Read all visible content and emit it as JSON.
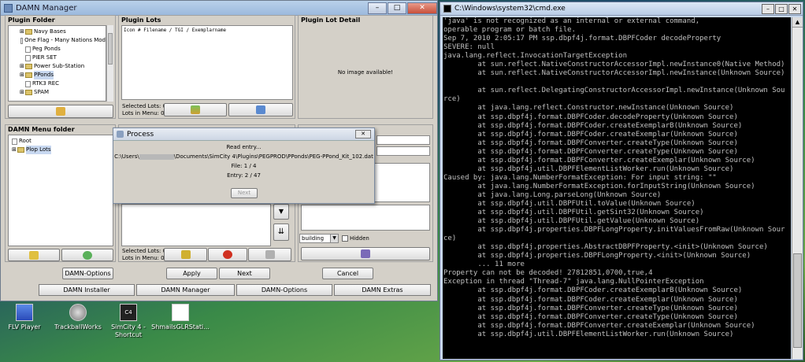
{
  "desktop": {
    "icons": [
      {
        "name": "flv-player-icon",
        "label": "FLV Player"
      },
      {
        "name": "trackball-works-icon",
        "label": "TrackballWorks"
      },
      {
        "name": "simcity4-shortcut-icon",
        "label": "SimCity 4 -",
        "label2": "Shortcut"
      },
      {
        "name": "shmails-icon",
        "label": "ShmailsGLRStati..."
      }
    ]
  },
  "damn": {
    "title": "DAMN Manager",
    "plugin_folder": {
      "title": "Plugin Folder",
      "items": [
        {
          "label": "Navy Bases",
          "type": "folder"
        },
        {
          "label": "One Flag - Many Nations Mod",
          "type": "file"
        },
        {
          "label": "Peg Ponds",
          "type": "file"
        },
        {
          "label": "PIER SET",
          "type": "file"
        },
        {
          "label": "Power Sub-Station",
          "type": "folder"
        },
        {
          "label": "PPonds",
          "type": "folder"
        },
        {
          "label": "RTK3 REC",
          "type": "file"
        },
        {
          "label": "SPAM",
          "type": "folder"
        }
      ]
    },
    "plugin_lots": {
      "title": "Plugin Lots",
      "header": "Icon # Filename / TGI / Exemplarname",
      "selected": "Selected Lots: 0",
      "in_menu": "Lots in Menu: 0"
    },
    "plugin_lot_detail": {
      "title": "Plugin Lot Detail",
      "no_image": "No image available!"
    },
    "menu_folder": {
      "title": "DAMN Menu folder",
      "items": [
        {
          "label": "Root"
        },
        {
          "label": "Plop Lots"
        }
      ]
    },
    "menu_lots": {
      "selected": "Selected Lots: 0",
      "in_menu": "Lots in Menu: 0"
    },
    "detail": {
      "combo_value": "building",
      "hidden_label": "Hidden"
    },
    "buttons": {
      "options": "DAMN-Options",
      "apply": "Apply",
      "next": "Next",
      "cancel": "Cancel"
    },
    "tabs": [
      "DAMN Installer",
      "DAMN Manager",
      "DAMN-Options",
      "DAMN Extras"
    ]
  },
  "process": {
    "title": "Process",
    "line1": "Read entry...",
    "path": "C:\\Users\\",
    "path_rest": "\\Documents\\SimCity 4\\Plugins\\PEGPROD\\PPonds\\PEG-PPond_Kit_102.dat",
    "file": "File: 1 / 4",
    "entry": "Entry: 2 / 47",
    "next": "Next"
  },
  "cmd": {
    "title": "C:\\Windows\\system32\\cmd.exe",
    "lines": [
      "'java' is not recognized as an internal or external command,",
      "operable program or batch file.",
      "Sep 7, 2010 2:05:17 PM ssp.dbpf4j.format.DBPFCoder decodeProperty",
      "SEVERE: null",
      "java.lang.reflect.InvocationTargetException",
      "        at sun.reflect.NativeConstructorAccessorImpl.newInstance0(Native Method)",
      "        at sun.reflect.NativeConstructorAccessorImpl.newInstance(Unknown Source)",
      "",
      "        at sun.reflect.DelegatingConstructorAccessorImpl.newInstance(Unknown Sou",
      "rce)",
      "        at java.lang.reflect.Constructor.newInstance(Unknown Source)",
      "        at ssp.dbpf4j.format.DBPFCoder.decodeProperty(Unknown Source)",
      "        at ssp.dbpf4j.format.DBPFCoder.createExemplarB(Unknown Source)",
      "        at ssp.dbpf4j.format.DBPFCoder.createExemplar(Unknown Source)",
      "        at ssp.dbpf4j.format.DBPFConverter.createType(Unknown Source)",
      "        at ssp.dbpf4j.format.DBPFConverter.createType(Unknown Source)",
      "        at ssp.dbpf4j.format.DBPFConverter.createExemplar(Unknown Source)",
      "        at ssp.dbpf4j.util.DBPFElementListWorker.run(Unknown Source)",
      "Caused by: java.lang.NumberFormatException: For input string: \"\"",
      "        at java.lang.NumberFormatException.forInputString(Unknown Source)",
      "        at java.lang.Long.parseLong(Unknown Source)",
      "        at ssp.dbpf4j.util.DBPFUtil.toValue(Unknown Source)",
      "        at ssp.dbpf4j.util.DBPFUtil.getSint32(Unknown Source)",
      "        at ssp.dbpf4j.util.DBPFUtil.getValue(Unknown Source)",
      "        at ssp.dbpf4j.properties.DBPFLongProperty.initValuesFromRaw(Unknown Sour",
      "ce)",
      "        at ssp.dbpf4j.properties.AbstractDBPFProperty.<init>(Unknown Source)",
      "        at ssp.dbpf4j.properties.DBPFLongProperty.<init>(Unknown Source)",
      "        ... 11 more",
      "Property can not be decoded! 27812851,0700,true,4",
      "Exception in thread \"Thread-7\" java.lang.NullPointerException",
      "        at ssp.dbpf4j.format.DBPFCoder.createExemplarB(Unknown Source)",
      "        at ssp.dbpf4j.format.DBPFCoder.createExemplar(Unknown Source)",
      "        at ssp.dbpf4j.format.DBPFConverter.createType(Unknown Source)",
      "        at ssp.dbpf4j.format.DBPFConverter.createType(Unknown Source)",
      "        at ssp.dbpf4j.format.DBPFConverter.createExemplar(Unknown Source)",
      "        at ssp.dbpf4j.util.DBPFElementListWorker.run(Unknown Source)"
    ]
  }
}
